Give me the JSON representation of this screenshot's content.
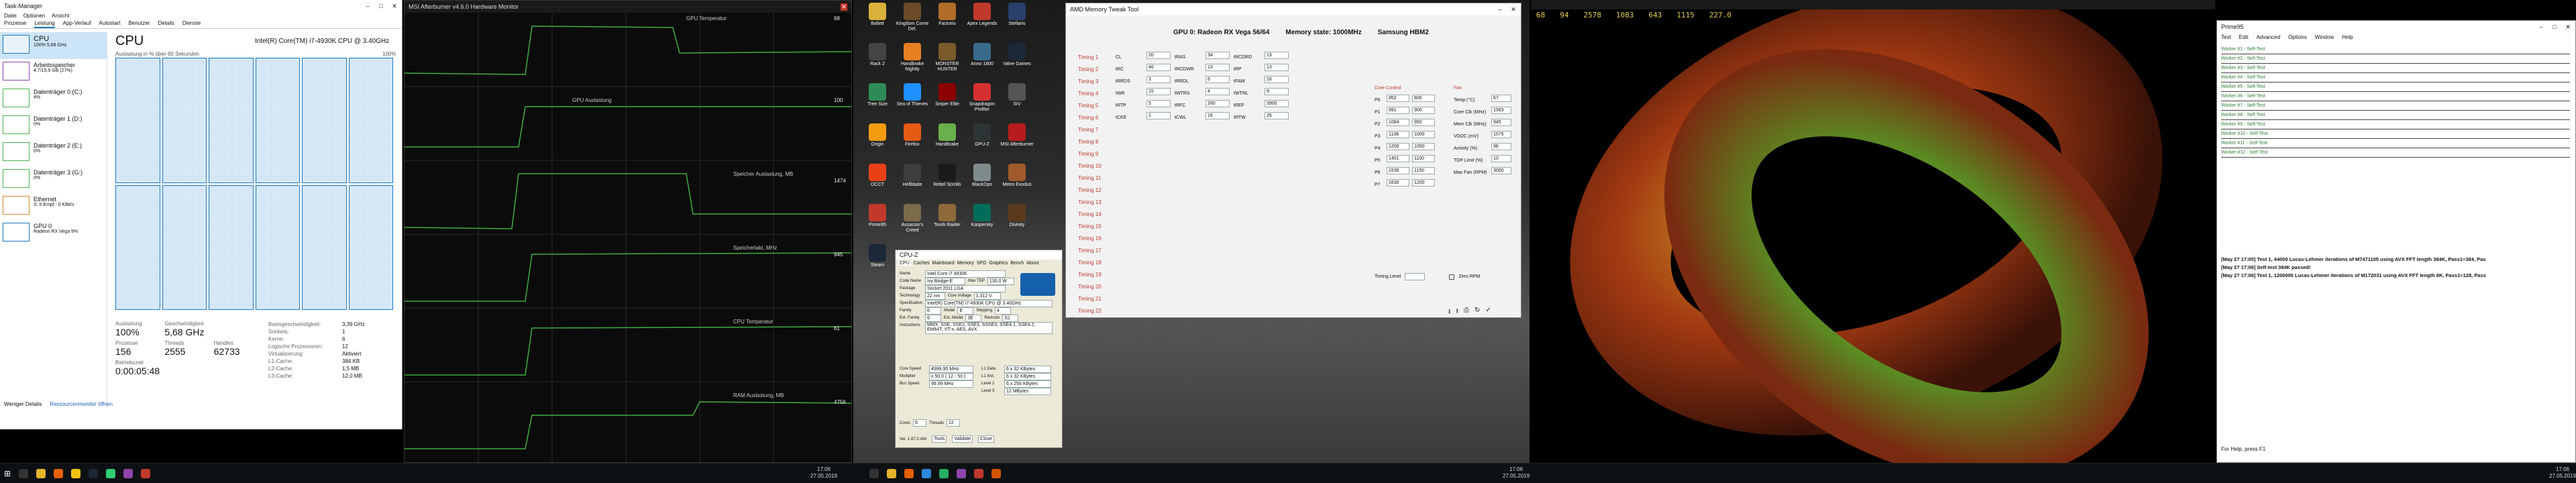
{
  "taskmgr": {
    "title": "Task-Manager",
    "menu": [
      "Datei",
      "Optionen",
      "Ansicht"
    ],
    "tabs": [
      "Prozesse",
      "Leistung",
      "App-Verlauf",
      "Autostart",
      "Benutzer",
      "Details",
      "Dienste"
    ],
    "side": [
      {
        "name": "CPU",
        "sub": "100% 5,68 GHz",
        "color": "#1a78c2"
      },
      {
        "name": "Arbeitsspeicher",
        "sub": "4,7/15,9 GB (27%)",
        "color": "#8e44ad"
      },
      {
        "name": "Datenträger 0 (C:)",
        "sub": "4%",
        "color": "#4caf50"
      },
      {
        "name": "Datenträger 1 (D:)",
        "sub": "0%",
        "color": "#4caf50"
      },
      {
        "name": "Datenträger 2 (E:)",
        "sub": "0%",
        "color": "#4caf50"
      },
      {
        "name": "Datenträger 3 (G:)",
        "sub": "0%",
        "color": "#4caf50"
      },
      {
        "name": "Ethernet",
        "sub": "S: 0 Empf.: 0 KBit/s",
        "color": "#c98b2b"
      },
      {
        "name": "GPU 0",
        "sub": "Radeon RX Vega 9%",
        "color": "#1a78c2"
      }
    ],
    "cpu_title": "CPU",
    "cpu_model": "Intel(R) Core(TM) i7-4930K CPU @ 3.40GHz",
    "graph_label": "Auslastung in % über 60 Sekunden",
    "graph_max": "100%",
    "stats": [
      {
        "k": "Auslastung",
        "v": "100%"
      },
      {
        "k": "Geschwindigkeit",
        "v": "5,68 GHz"
      },
      {
        "k": "Prozesse",
        "v": "156"
      },
      {
        "k": "Threads",
        "v": "2555"
      },
      {
        "k": "Handles",
        "v": "62733"
      },
      {
        "k": "Betriebszeit",
        "v": "0:00:05:48"
      }
    ],
    "specs": [
      [
        "Basisgeschwindigkeit:",
        "3,39 GHz"
      ],
      [
        "Sockets:",
        "1"
      ],
      [
        "Kerne:",
        "6"
      ],
      [
        "Logische Prozessoren:",
        "12"
      ],
      [
        "Virtualisierung:",
        "Aktiviert"
      ],
      [
        "L1-Cache:",
        "384 KB"
      ],
      [
        "L2-Cache:",
        "1,5 MB"
      ],
      [
        "L3-Cache:",
        "12,0 MB"
      ]
    ],
    "footer_less": "Weniger Details",
    "footer_res": "Ressourcenmonitor öffnen"
  },
  "afterburner": {
    "title": "MSI Afterburner v4.6.0 Hardware Monitor",
    "graphs": [
      {
        "label": "GPU Temperatur",
        "value": "68"
      },
      {
        "label": "GPU Auslastung",
        "value": "100"
      },
      {
        "label": "Speicher Auslastung, MB",
        "value": "1474"
      },
      {
        "label": "Speichertakt, MHz",
        "value": "945"
      },
      {
        "label": "CPU Temperatur",
        "value": "61"
      },
      {
        "label": "RAM Auslastung, MB",
        "value": "4756"
      }
    ]
  },
  "desktop": {
    "icons": [
      "Ballett",
      "Kingdom Come Del.",
      "Factorio",
      "Apex Legends",
      "Stellaris",
      "Rack 2",
      "Handbrake Nightly",
      "MONSTER HUNTER",
      "Anno 1800",
      "Valve Games",
      "Tree Size",
      "Sea of Thieves",
      "Sniper Elite",
      "Snapdragon Profiler",
      "SIV",
      "Origin",
      "Firefox",
      "Handbrake",
      "GPU-Z",
      "MSI Afterburner",
      "OCCT",
      "Hellblade",
      "Rebel Scrolls",
      "BlackOps",
      "Metro Exodus",
      "Prime95",
      "Assassin's Creed",
      "Tomb Raider",
      "Kaspersky",
      "Divinity",
      "Steam"
    ]
  },
  "memtweak": {
    "title": "AMD Memory Tweak Tool",
    "gpu": "GPU 0: Radeon RX Vega 56/64",
    "memstate": "Memory state: 1000MHz",
    "memtype": "Samsung HBM2",
    "timings": [
      "Timing 1",
      "Timing 2",
      "Timing 3",
      "Timing 4",
      "Timing 5",
      "Timing 6",
      "Timing 7",
      "Timing 8",
      "Timing 9",
      "Timing 10",
      "Timing 11",
      "Timing 12",
      "Timing 13",
      "Timing 14",
      "Timing 15",
      "Timing 16",
      "Timing 17",
      "Timing 18",
      "Timing 19",
      "Timing 20",
      "Timing 21",
      "Timing 22"
    ],
    "left_rows": [
      [
        "CL",
        "20",
        "tRAS",
        "34",
        "tRCDRD",
        "13"
      ],
      [
        "tRC",
        "46",
        "tRCDWR",
        "13",
        "tRP",
        "13"
      ],
      [
        "tRRDS",
        "3",
        "tRRDL",
        "6",
        "tFAW",
        "16"
      ],
      [
        "tWR",
        "15",
        "tWTRS",
        "4",
        "tWTRL",
        "9"
      ],
      [
        "tRTP",
        "5",
        "tRFC",
        "260",
        "tREF",
        "3900"
      ],
      [
        "tCKE",
        "1",
        "tCWL",
        "16",
        "tRTW",
        "26"
      ]
    ],
    "clock_title": "Core Control",
    "clock_rows": [
      [
        "P0",
        "852",
        "800"
      ],
      [
        "P1",
        "991",
        "900"
      ],
      [
        "P2",
        "1084",
        "950"
      ],
      [
        "P3",
        "1138",
        "1000"
      ],
      [
        "P4",
        "1200",
        "1050"
      ],
      [
        "P5",
        "1401",
        "1100"
      ],
      [
        "P6",
        "1536",
        "1150"
      ],
      [
        "P7",
        "1630",
        "1200"
      ]
    ],
    "fan_title": "Fan",
    "fan_rows": [
      [
        "Temp (°C)",
        "67"
      ],
      [
        "Core Clk (MHz)",
        "1583"
      ],
      [
        "Mem Clk (MHz)",
        "945"
      ],
      [
        "VDDC (mV)",
        "1075"
      ],
      [
        "Activity (%)",
        "96"
      ],
      [
        "TDP Limit (%)",
        "10"
      ],
      [
        "Max Fan (RPM)",
        "3000"
      ]
    ],
    "timing_level": "Timing Level",
    "zero_rpm": "Zero RPM"
  },
  "cpuz": {
    "title": "CPU-Z",
    "tabs": [
      "CPU",
      "Caches",
      "Mainboard",
      "Memory",
      "SPD",
      "Graphics",
      "Bench",
      "About"
    ],
    "name": "Intel Core i7 4930K",
    "codename": "Ivy Bridge-E",
    "maxtdp": "130.0 W",
    "package": "Socket 2011 LGA",
    "technology": "22 nm",
    "voltage": "1.312 V",
    "spec": "Intel(R) Core(TM) i7-4930K CPU @ 3.40GHz",
    "family": "6",
    "model": "E",
    "stepping": "4",
    "extfamily": "6",
    "extmodel": "3E",
    "revision": "S1",
    "instructions": "MMX, SSE, SSE2, SSE3, SSSE3, SSE4.1, SSE4.2, EM64T, VT-x, AES, AVX",
    "corespeed": "4999.95 MHz",
    "multiplier": "x 50.0 ( 12 - 50 )",
    "busspeed": "99.99 MHz",
    "l1d": "6 x 32 KBytes",
    "l1i": "6 x 32 KBytes",
    "l2": "6 x 256 KBytes",
    "l3": "12 MBytes",
    "cores": "6",
    "threads": "12",
    "version": "Ver. 1.87.0.x64",
    "tools": "Tools",
    "validate": "Validate",
    "close": "Close"
  },
  "prime95": {
    "title": "Prime95",
    "menu": [
      "Test",
      "Edit",
      "Advanced",
      "Options",
      "Window",
      "Help"
    ],
    "workers": [
      "Worker #1 - Self-Test",
      "Worker #2 - Self-Test",
      "Worker #3 - Self-Test",
      "Worker #4 - Self-Test",
      "Worker #5 - Self-Test",
      "Worker #6 - Self-Test",
      "Worker #7 - Self-Test",
      "Worker #8 - Self-Test",
      "Worker #9 - Self-Test",
      "Worker #10 - Self-Test",
      "Worker #11 - Self-Test",
      "Worker #12 - Self-Test"
    ],
    "log": [
      "[May 27 17:05] Test 1, 44000 Lucas-Lehmer iterations of M7471105 using AVX FFT length 384K, Pass1=384, Pas",
      "[May 27 17:06] Self-test 384K passed!",
      "[May 27 17:06] Test 1, 1200000 Lucas-Lehmer iterations of M172031 using AVX FFT length 8K, Pass1=128, Pass"
    ],
    "help": "For Help, press F1"
  },
  "overlay": {
    "values": [
      "68",
      "94",
      "2578",
      "1083",
      "643",
      "1115",
      "227.0"
    ]
  },
  "taskbar": {
    "clock1": "17:06",
    "date1": "27.05.2019",
    "clock2": "17:06",
    "date2": "27.05.2019",
    "clock3": "17:06",
    "date3": "27.05.2019"
  }
}
